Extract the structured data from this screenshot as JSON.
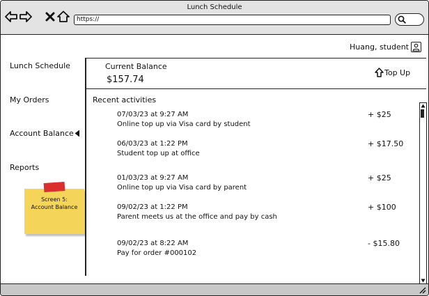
{
  "window": {
    "title": "Lunch Schedule"
  },
  "browser": {
    "url": "https://"
  },
  "user": {
    "label": "Huang, student",
    "icon": "user-icon"
  },
  "sidebar": {
    "items": [
      {
        "label": "Lunch Schedule"
      },
      {
        "label": "My Orders"
      },
      {
        "label": "Account Balance",
        "active": true
      },
      {
        "label": "Reports"
      }
    ]
  },
  "balance": {
    "label": "Current Balance",
    "value": "$157.74",
    "topup_label": "Top Up"
  },
  "activities": {
    "heading": "Recent activities",
    "items": [
      {
        "date": "07/03/23 at 9:27 AM",
        "desc": "Online top up via Visa card by student",
        "amount": "+ $25"
      },
      {
        "date": "06/03/23 at 1:22 PM",
        "desc": "Student top up at office",
        "amount": "+ $17.50"
      },
      {
        "date": "01/03/23 at 9:27 AM",
        "desc": "Online top up via Visa card by parent",
        "amount": "+ $25"
      },
      {
        "date": "09/02/23 at 1:22 PM",
        "desc": "Parent meets us at the office and pay by cash",
        "amount": "+ $100"
      },
      {
        "date": "09/02/23 at 8:22 AM",
        "desc": "Pay for order #000102",
        "amount": "- $15.80"
      }
    ]
  },
  "sticky_note": {
    "text": "Screen 5:\nAccount Balance"
  },
  "colors": {
    "chrome": "#e3e3e3",
    "sticky": "#f5d45a",
    "tape": "#d9302e",
    "footer": "#c8c8c8"
  }
}
